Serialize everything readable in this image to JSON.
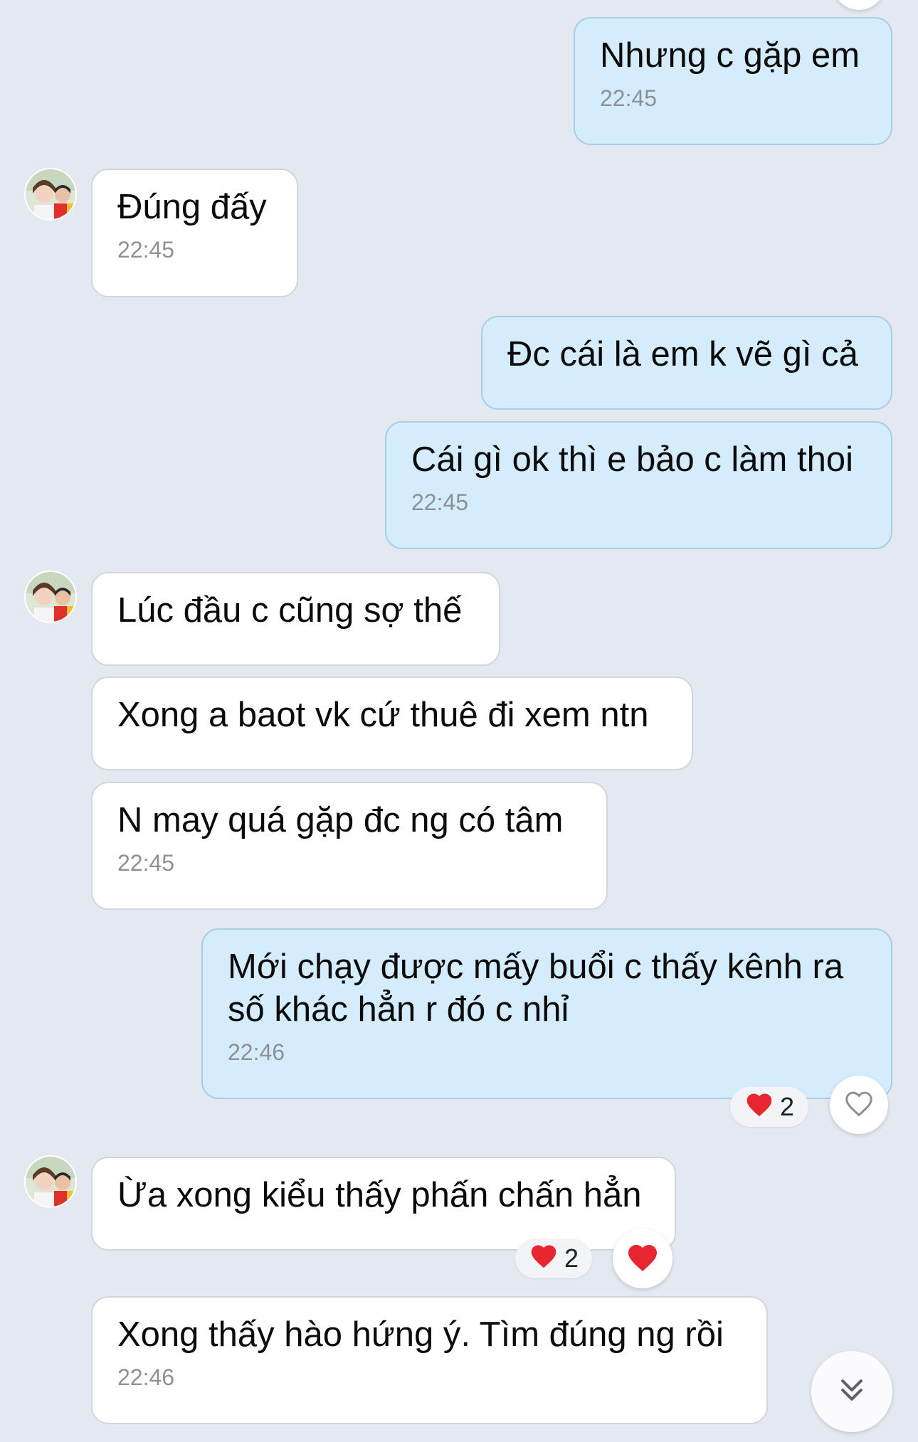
{
  "messages": [
    {
      "side": "out",
      "text": "Nhưng c gặp em",
      "time": "22:45"
    },
    {
      "side": "in",
      "text": "Đúng đấy",
      "time": "22:45"
    },
    {
      "side": "out",
      "text": "Đc cái là em k vẽ gì cả"
    },
    {
      "side": "out",
      "text": "Cái gì ok thì e bảo c làm thoi",
      "time": "22:45"
    },
    {
      "side": "in",
      "text": "Lúc đầu c cũng sợ thế"
    },
    {
      "side": "in",
      "text": "Xong a baot vk cứ thuê đi xem ntn"
    },
    {
      "side": "in",
      "text": "N may quá gặp đc ng có tâm",
      "time": "22:45"
    },
    {
      "side": "out",
      "text": "Mới chạy được mấy buổi c thấy kênh ra\nsố khác hẳn r đó c nhỉ",
      "time": "22:46",
      "reaction_count": "2"
    },
    {
      "side": "in",
      "text": "Ừa xong kiểu thấy phấn chấn hẳn",
      "reaction_count": "2"
    },
    {
      "side": "in",
      "text": "Xong thấy hào hứng ý. Tìm đúng ng rồi",
      "time": "22:46"
    }
  ],
  "icons": {
    "heart": "heart-icon",
    "heart_outline": "heart-outline-icon",
    "scroll_down": "double-chevron-down-icon",
    "avatar": "contact-avatar"
  },
  "colors": {
    "background": "#e4e8f1",
    "outgoing_bubble": "#d4ecfb",
    "incoming_bubble": "#ffffff",
    "heart": "#e8262f"
  }
}
